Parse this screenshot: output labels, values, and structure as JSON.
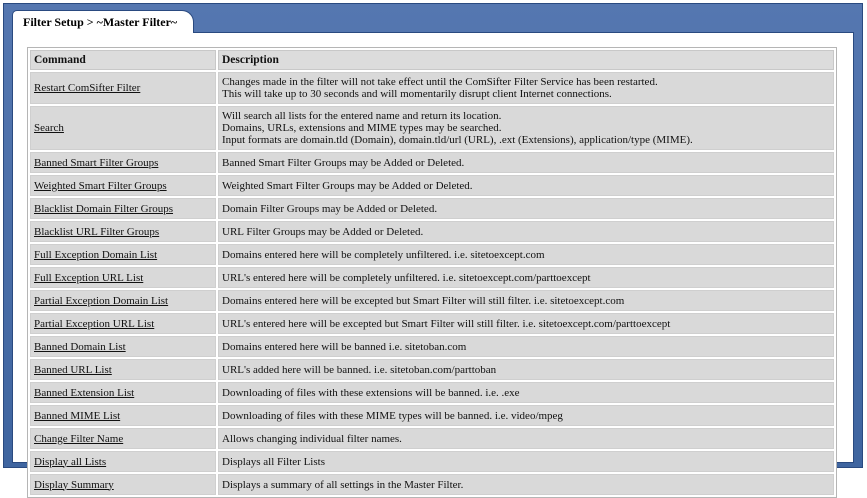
{
  "tab": {
    "title": "Filter Setup > ~Master Filter~"
  },
  "table": {
    "headers": {
      "command": "Command",
      "description": "Description"
    },
    "rows": [
      {
        "command": "Restart ComSifter Filter",
        "description": [
          "Changes made in the filter will not take effect until the ComSifter Filter Service has been restarted.",
          "This will take up to 30 seconds and will momentarily disrupt client Internet connections."
        ]
      },
      {
        "command": "Search",
        "description": [
          "Will search all lists for the entered name and return its location.",
          "Domains, URLs, extensions and MIME types may be searched.",
          "Input formats are domain.tld (Domain), domain.tld/url (URL), .ext (Extensions), application/type (MIME)."
        ]
      },
      {
        "command": "Banned Smart Filter Groups",
        "description": [
          "Banned Smart Filter Groups may be Added or Deleted."
        ]
      },
      {
        "command": "Weighted Smart Filter Groups",
        "description": [
          "Weighted Smart Filter Groups may be Added or Deleted."
        ]
      },
      {
        "command": "Blacklist Domain Filter Groups",
        "description": [
          "Domain Filter Groups may be Added or Deleted."
        ]
      },
      {
        "command": "Blacklist URL Filter Groups",
        "description": [
          "URL Filter Groups may be Added or Deleted."
        ]
      },
      {
        "command": "Full Exception Domain List",
        "description": [
          "Domains entered here will be completely unfiltered. i.e. sitetoexcept.com"
        ]
      },
      {
        "command": "Full Exception URL List",
        "description": [
          "URL's entered here will be completely unfiltered. i.e. sitetoexcept.com/parttoexcept"
        ]
      },
      {
        "command": "Partial Exception Domain List",
        "description": [
          "Domains entered here will be excepted but Smart Filter will still filter. i.e. sitetoexcept.com"
        ]
      },
      {
        "command": "Partial Exception URL List",
        "description": [
          "URL's entered here will be excepted but Smart Filter will still filter. i.e. sitetoexcept.com/parttoexcept"
        ]
      },
      {
        "command": "Banned Domain List",
        "description": [
          "Domains entered here will be banned i.e. sitetoban.com"
        ]
      },
      {
        "command": "Banned URL List",
        "description": [
          "URL's added here will be banned. i.e. sitetoban.com/parttoban"
        ]
      },
      {
        "command": "Banned Extension List",
        "description": [
          "Downloading of files with these extensions will be banned. i.e. .exe"
        ]
      },
      {
        "command": "Banned MIME List",
        "description": [
          "Downloading of files with these MIME types will be banned. i.e. video/mpeg"
        ]
      },
      {
        "command": "Change Filter Name",
        "description": [
          "Allows changing individual filter names."
        ]
      },
      {
        "command": "Display all Lists",
        "description": [
          "Displays all Filter Lists"
        ]
      },
      {
        "command": "Display Summary",
        "description": [
          "Displays a summary of all settings in the Master Filter."
        ]
      }
    ]
  }
}
